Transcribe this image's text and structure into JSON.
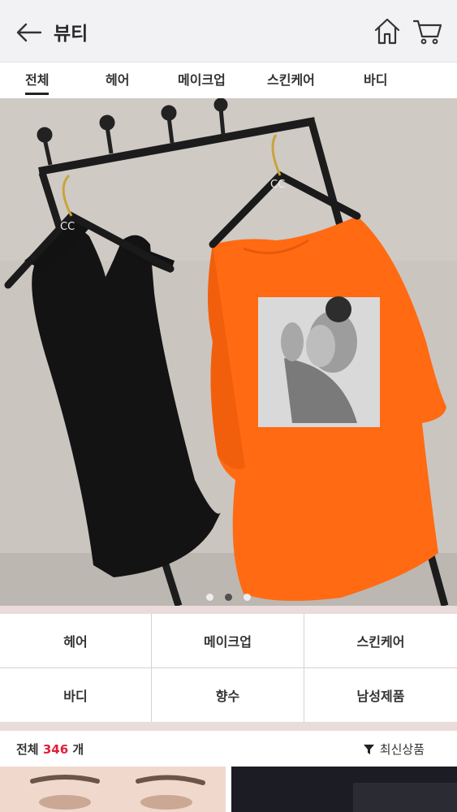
{
  "header": {
    "title": "뷰티"
  },
  "tabs": [
    {
      "label": "전체"
    },
    {
      "label": "헤어"
    },
    {
      "label": "메이크업"
    },
    {
      "label": "스킨케어"
    },
    {
      "label": "바디"
    }
  ],
  "carousel": {
    "slide_count": 3,
    "active_index": 1
  },
  "categories": [
    {
      "label": "헤어"
    },
    {
      "label": "메이크업"
    },
    {
      "label": "스킨케어"
    },
    {
      "label": "바디"
    },
    {
      "label": "향수"
    },
    {
      "label": "남성제품"
    }
  ],
  "list": {
    "total_prefix": "전체",
    "total_count": "346",
    "total_suffix": "개",
    "sort_label": "최신상품"
  },
  "icons": [
    "back-arrow-icon",
    "home-icon",
    "cart-icon",
    "filter-icon"
  ],
  "colors": {
    "accent": "#e0203a",
    "header_bg": "#f2f2f5",
    "shirt": "#ff6a13"
  }
}
